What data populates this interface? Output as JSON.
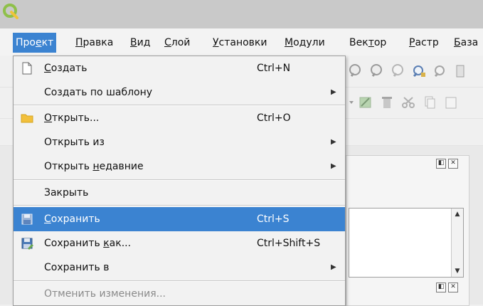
{
  "menubar": {
    "items": [
      {
        "pre": "Про",
        "u": "е",
        "post": "кт"
      },
      {
        "pre": "",
        "u": "П",
        "post": "равка"
      },
      {
        "pre": "",
        "u": "В",
        "post": "ид"
      },
      {
        "pre": "",
        "u": "С",
        "post": "лой"
      },
      {
        "pre": "",
        "u": "У",
        "post": "становки"
      },
      {
        "pre": "",
        "u": "М",
        "post": "одули"
      },
      {
        "pre": "Век",
        "u": "т",
        "post": "ор"
      },
      {
        "pre": "",
        "u": "Р",
        "post": "астр"
      },
      {
        "pre": "",
        "u": "Б",
        "post": "аза"
      }
    ]
  },
  "menu": {
    "items": [
      {
        "pre": "",
        "u": "С",
        "post": "оздать",
        "shortcut": "Ctrl+N"
      },
      {
        "pre": "Создать по шаблону",
        "u": "",
        "post": ""
      },
      {
        "pre": "",
        "u": "О",
        "post": "ткрыть...",
        "shortcut": "Ctrl+O"
      },
      {
        "pre": "Открыть из",
        "u": "",
        "post": ""
      },
      {
        "pre": "Открыть ",
        "u": "н",
        "post": "едавние"
      },
      {
        "pre": "Закрыть",
        "u": "",
        "post": ""
      },
      {
        "pre": "",
        "u": "С",
        "post": "охранить",
        "shortcut": "Ctrl+S"
      },
      {
        "pre": "Сохранить ",
        "u": "к",
        "post": "ак...",
        "shortcut": "Ctrl+Shift+S"
      },
      {
        "pre": "Сохранить в",
        "u": "",
        "post": ""
      },
      {
        "pre": "Отменить изменения...",
        "u": "",
        "post": ""
      }
    ]
  },
  "colors": {
    "accent": "#3b83d1",
    "qgis_green": "#8fc04a",
    "folder": "#f2c03c",
    "save_blue": "#4a79b6"
  }
}
